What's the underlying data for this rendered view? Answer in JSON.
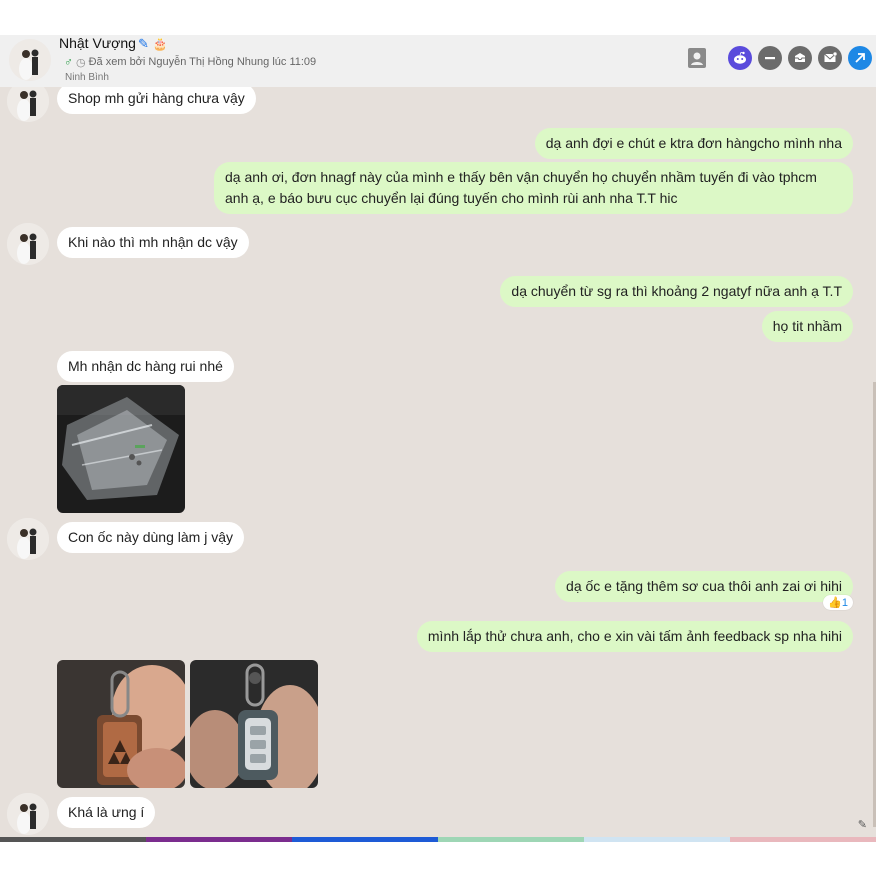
{
  "header": {
    "name": "Nhật Vượng",
    "seen_text": "Đã xem bởi Nguyễn Thị Hồng Nhung lúc 11:09",
    "location": "Ninh Bình",
    "icons": [
      "contact-card-icon",
      "reddit-icon",
      "minus-icon",
      "inbox-icon",
      "mail-icon",
      "open-external-icon"
    ]
  },
  "messages": [
    {
      "dir": "in",
      "text": "Shop mh gửi hàng chưa vậy"
    },
    {
      "dir": "out",
      "text": "dạ anh đợi e chút e ktra đơn hàngcho mình nha"
    },
    {
      "dir": "out",
      "text": "dạ anh ơi, đơn hnagf này của mình e thấy bên vận chuyển họ chuyển nhầm tuyến đi vào tphcm anh ạ, e báo bưu cục chuyển lại đúng tuyến cho mình rùi anh nha T.T hic"
    },
    {
      "dir": "in",
      "text": "Khi nào thì mh nhận dc vậy"
    },
    {
      "dir": "out",
      "text": "dạ chuyển từ sg ra thì khoảng 2 ngatyf nữa anh ạ T.T"
    },
    {
      "dir": "out",
      "text": "họ tit nhầm"
    },
    {
      "dir": "in",
      "text": "Mh nhận dc hàng rui nhé"
    },
    {
      "dir": "in",
      "text": "Con ốc này dùng làm j vậy"
    },
    {
      "dir": "out",
      "text": "dạ ốc e tặng thêm sơ cua thôi anh zai ơi hihi"
    },
    {
      "dir": "out",
      "text": "mình lắp thử chưa anh, cho e xin vài tấm ảnh feedback sp nha hihi"
    },
    {
      "dir": "in",
      "text": "Khá là ưng í"
    }
  ],
  "reaction": {
    "emoji": "👍",
    "count": "1"
  },
  "photos": [
    {
      "name": "screw-bag-photo"
    },
    {
      "name": "key-case-photo-1"
    },
    {
      "name": "key-case-photo-2"
    }
  ],
  "colors": {
    "chat_background": "#e6e0db",
    "incoming_bubble": "#ffffff",
    "outgoing_bubble": "#dcf8c6",
    "bottom_bar": [
      "#555555",
      "#7b2d8e",
      "#1e5bd6",
      "#9ed6b5",
      "#d0e4f2",
      "#e9b8bd"
    ]
  }
}
